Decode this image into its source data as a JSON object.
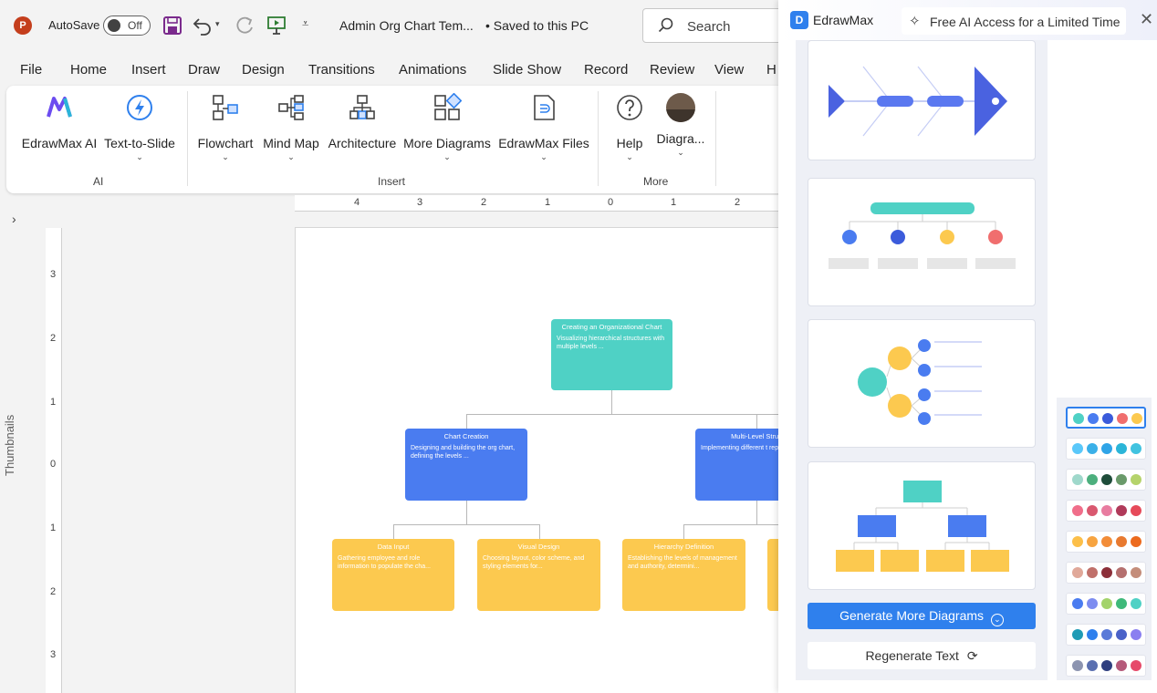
{
  "titlebar": {
    "autosave_label": "AutoSave",
    "autosave_state": "Off",
    "doc_title": "Admin Org Chart Tem...",
    "doc_status": "• Saved to this PC",
    "search_placeholder": "Search"
  },
  "menu": [
    "File",
    "Home",
    "Insert",
    "Draw",
    "Design",
    "Transitions",
    "Animations",
    "Slide Show",
    "Record",
    "Review",
    "View",
    "H"
  ],
  "ribbon": {
    "groups": {
      "ai": "AI",
      "insert": "Insert",
      "more": "More"
    },
    "buttons": {
      "edrawmax_ai": "EdrawMax AI",
      "text_to_slide": "Text-to-Slide",
      "flowchart": "Flowchart",
      "mind_map": "Mind Map",
      "architecture": "Architecture",
      "more_diagrams": "More Diagrams",
      "edrawmax_files": "EdrawMax Files",
      "help": "Help",
      "diagram": "Diagra..."
    }
  },
  "thumbnails_label": "Thumbnails",
  "ruler": {
    "h": [
      "4",
      "3",
      "2",
      "1",
      "0",
      "1",
      "2"
    ],
    "v": [
      "3",
      "2",
      "1",
      "0",
      "1",
      "2",
      "3"
    ]
  },
  "slide": {
    "root": {
      "title": "Creating an Organizational Chart",
      "desc": "Visualizing hierarchical structures with multiple levels ..."
    },
    "level1": [
      {
        "title": "Chart Creation",
        "desc": "Designing and building the org chart, defining the levels ..."
      },
      {
        "title": "Multi-Level Struc",
        "desc": "Implementing different t represent ..."
      }
    ],
    "level2": [
      {
        "title": "Data Input",
        "desc": "Gathering employee and role information to populate the cha..."
      },
      {
        "title": "Visual Design",
        "desc": "Choosing layout, color scheme, and styling elements for..."
      },
      {
        "title": "Hierarchy Definition",
        "desc": "Establishing the levels of management and authority, determini..."
      }
    ],
    "colors": {
      "root": "#4fd1c5",
      "level1": "#4a7cf0",
      "level2": "#fcc94f"
    }
  },
  "panel": {
    "brand": "EdrawMax",
    "promo": "Free AI Access for a Limited Time",
    "generate_more": "Generate More Diagrams",
    "regenerate": "Regenerate Text",
    "palettes": [
      [
        "#4fd1c5",
        "#4a7cf0",
        "#3b5bdb",
        "#f06e6e",
        "#fcc94f"
      ],
      [
        "#5ac8fa",
        "#3ab0e8",
        "#2fa4e7",
        "#2bb5d8",
        "#41c3e0"
      ],
      [
        "#9fd8cb",
        "#4caf7d",
        "#1f4d3a",
        "#6a9a6a",
        "#b5d36b"
      ],
      [
        "#f06e8a",
        "#d9586f",
        "#e87ca0",
        "#b03a5a",
        "#e64a5a"
      ],
      [
        "#fcbf49",
        "#f7a440",
        "#f28c38",
        "#e87a30",
        "#ec6a1e"
      ],
      [
        "#e0a899",
        "#c0706a",
        "#8c2f39",
        "#b5706f",
        "#c48d7a"
      ],
      [
        "#4a7cf0",
        "#7d8cf0",
        "#a3d36b",
        "#3fb97a",
        "#4fd1c5"
      ],
      [
        "#1f9bb5",
        "#2f80ed",
        "#5a7ad8",
        "#4a62c8",
        "#8a7ff0"
      ],
      [
        "#8c94b0",
        "#5a6fb0",
        "#2f3f7f",
        "#b55a7a",
        "#e64a6a"
      ]
    ]
  }
}
